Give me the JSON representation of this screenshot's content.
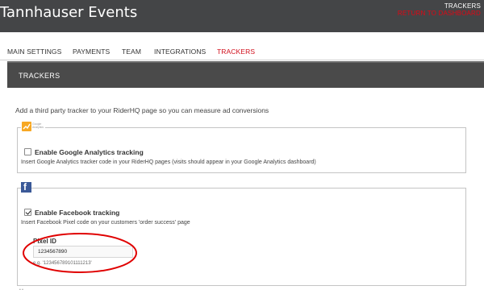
{
  "header": {
    "app_title": "Tannhauser Events",
    "section_label": "TRACKERS",
    "return_link": "RETURN TO DASHBOARD"
  },
  "tabs": [
    {
      "label": "MAIN SETTINGS",
      "active": false
    },
    {
      "label": "PAYMENTS",
      "active": false
    },
    {
      "label": "TEAM",
      "active": false
    },
    {
      "label": "INTEGRATIONS",
      "active": false
    },
    {
      "label": "TRACKERS",
      "active": true
    }
  ],
  "section": {
    "title": "TRACKERS",
    "intro": "Add a third party tracker to your RiderHQ page so you can measure ad conversions"
  },
  "google_analytics": {
    "logo_icon": "google-analytics-logo",
    "logo_text": "Google Analytics",
    "checkbox_label": "Enable Google Analytics tracking",
    "checked": false,
    "description": "Insert Google Analytics tracker code in your RiderHQ pages (visits should appear in your Google Analytics dashboard)"
  },
  "facebook": {
    "logo_icon": "facebook-logo",
    "logo_text": "f",
    "checkbox_label": "Enable Facebook tracking",
    "checked": true,
    "description": "Insert Facebook Pixel code on your customers 'order success' page",
    "pixel_id_label": "Pixel ID",
    "pixel_id_value": "1234567890",
    "pixel_id_example": "e.g. '123456789101111213'"
  },
  "colors": {
    "topbar": "#444547",
    "accent_red": "#d10f1c",
    "section_header": "#4a4a4a",
    "facebook_blue": "#3b5998",
    "ga_orange": "#f7a823",
    "annotation_red": "#e00000"
  }
}
